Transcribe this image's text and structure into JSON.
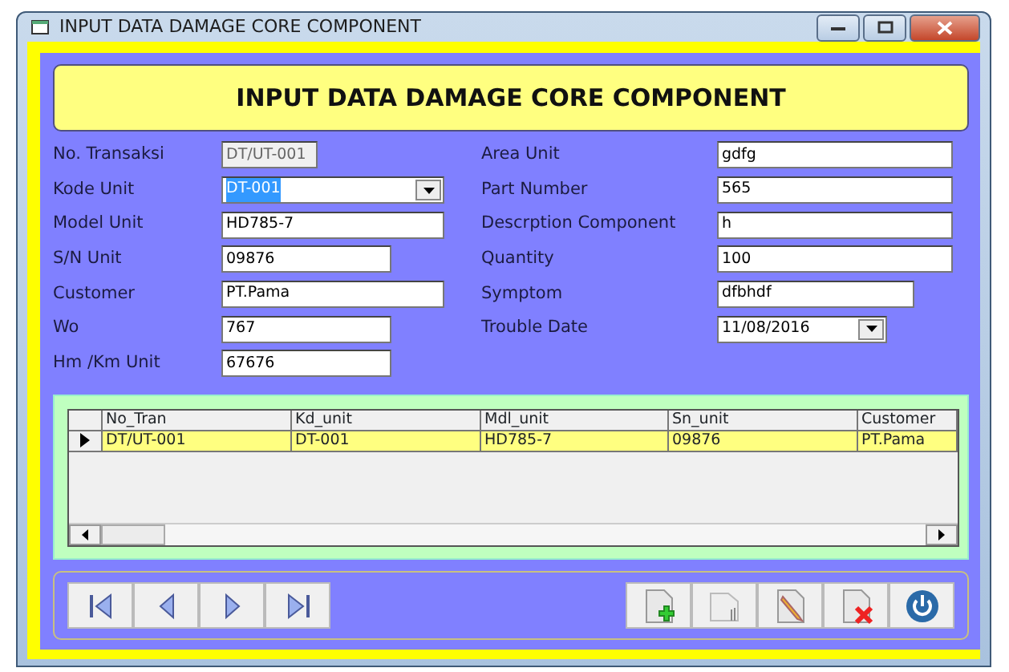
{
  "window": {
    "title": "INPUT DATA DAMAGE CORE COMPONENT"
  },
  "header": "INPUT DATA DAMAGE CORE COMPONENT",
  "left_fields": [
    {
      "label": "No. Transaksi",
      "value": "DT/UT-001",
      "kind": "text",
      "disabled": true,
      "highlighted": false
    },
    {
      "label": "Kode Unit",
      "value": "DT-001",
      "kind": "combo",
      "disabled": false,
      "highlighted": true
    },
    {
      "label": "Model Unit",
      "value": "HD785-7",
      "kind": "text",
      "disabled": false,
      "highlighted": false
    },
    {
      "label": "S/N Unit",
      "value": "09876",
      "kind": "text",
      "disabled": false,
      "highlighted": false
    },
    {
      "label": "Customer",
      "value": "PT.Pama",
      "kind": "text",
      "disabled": false,
      "highlighted": false
    },
    {
      "label": "Wo",
      "value": "767",
      "kind": "text",
      "disabled": false,
      "highlighted": false
    },
    {
      "label": "Hm /Km Unit",
      "value": "67676",
      "kind": "text",
      "disabled": false,
      "highlighted": false
    }
  ],
  "right_fields": [
    {
      "label": "Area Unit",
      "value": "gdfg",
      "kind": "text",
      "disabled": false,
      "highlighted": false
    },
    {
      "label": "Part Number",
      "value": "565",
      "kind": "text",
      "disabled": false,
      "highlighted": false
    },
    {
      "label": "Descrption Component",
      "value": "h",
      "kind": "text",
      "disabled": false,
      "highlighted": false
    },
    {
      "label": "Quantity",
      "value": "100",
      "kind": "text",
      "disabled": false,
      "highlighted": false
    },
    {
      "label": "Symptom",
      "value": "dfbhdf",
      "kind": "text",
      "disabled": false,
      "highlighted": false
    },
    {
      "label": "Trouble Date",
      "value": "11/08/2016",
      "kind": "combo",
      "disabled": false,
      "highlighted": false
    }
  ],
  "table": {
    "columns": [
      "No_Tran",
      "Kd_unit",
      "Mdl_unit",
      "Sn_unit",
      "Customer"
    ],
    "rows": [
      {
        "cells": [
          "DT/UT-001",
          "DT-001",
          "HD785-7",
          "09876",
          "PT.Pama"
        ],
        "selected": true
      }
    ]
  },
  "nav_buttons": [
    {
      "kind": "first"
    },
    {
      "kind": "prev"
    },
    {
      "kind": "next"
    },
    {
      "kind": "last"
    }
  ],
  "action_buttons": [
    {
      "kind": "add"
    },
    {
      "kind": "save"
    },
    {
      "kind": "edit"
    },
    {
      "kind": "delete"
    },
    {
      "kind": "exit"
    }
  ]
}
